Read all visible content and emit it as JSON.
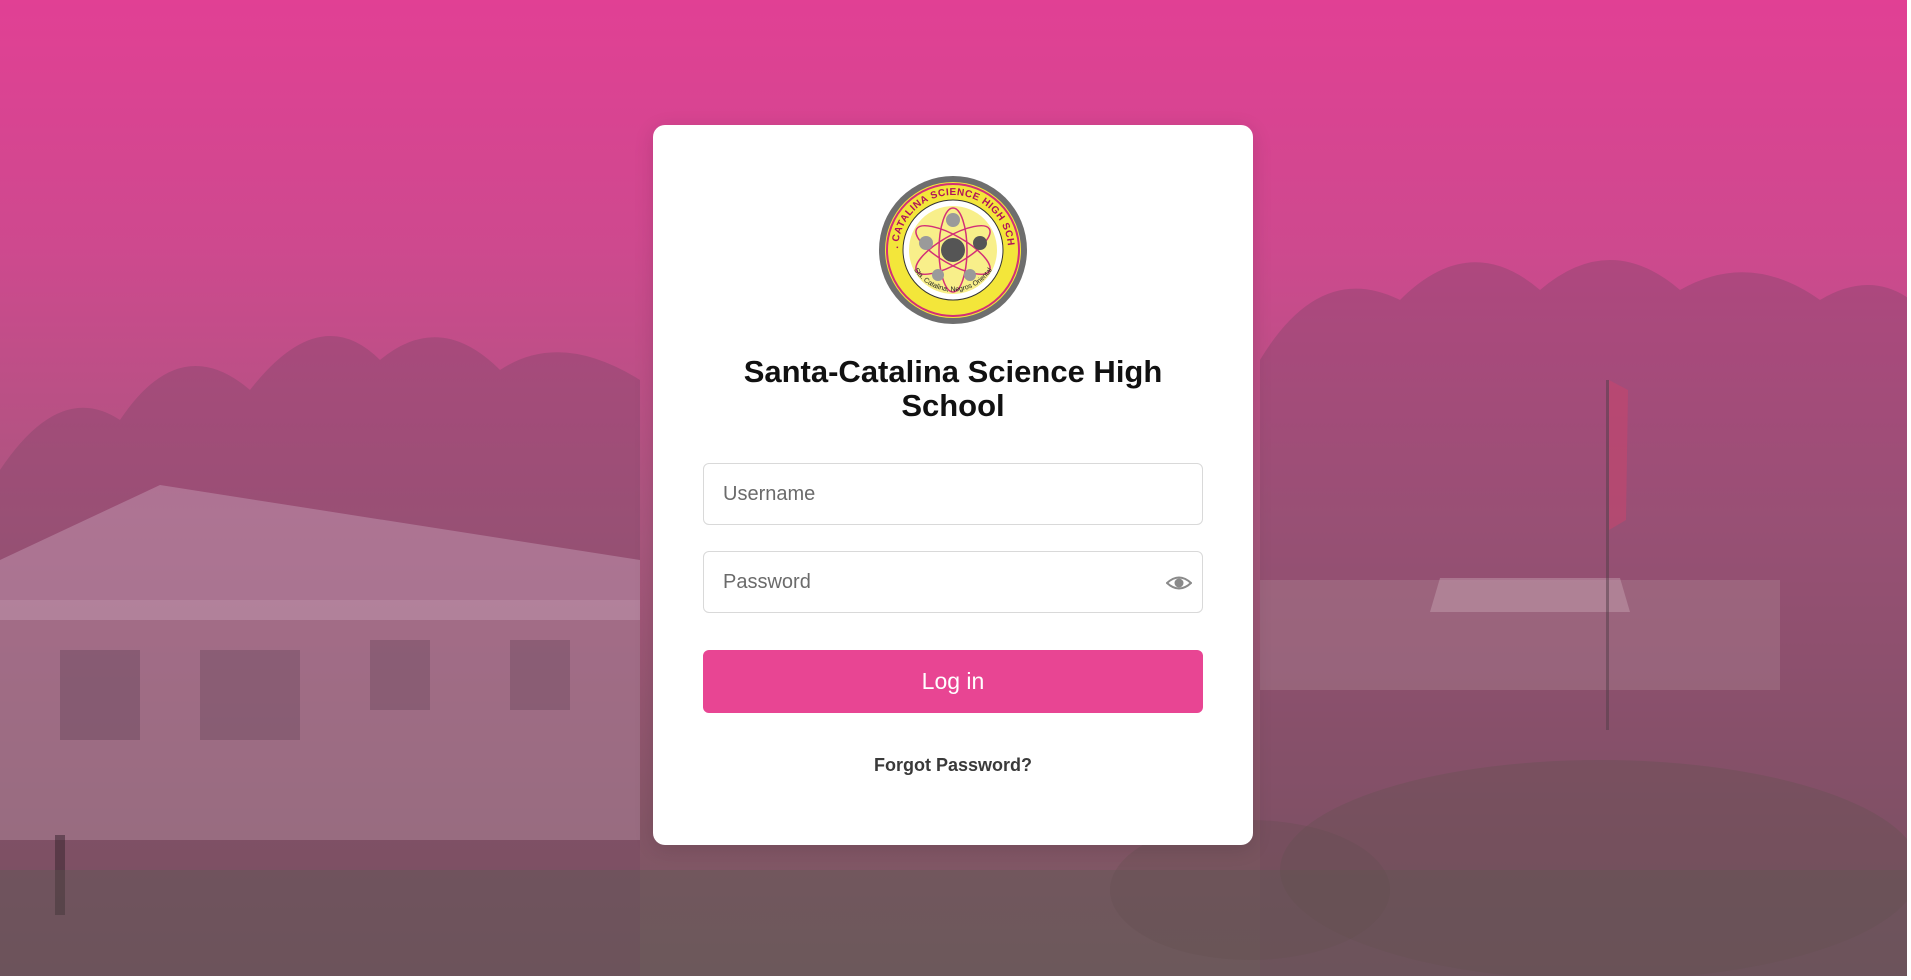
{
  "school": {
    "name": "Santa-Catalina Science High School",
    "seal_text_top": "STA. CATALINA SCIENCE HIGH SCHOOL",
    "seal_text_bottom": "Sta. Catalina, Negros Oriental"
  },
  "form": {
    "username_placeholder": "Username",
    "username_value": "",
    "password_placeholder": "Password",
    "password_value": "",
    "login_label": "Log in",
    "forgot_label": "Forgot Password?"
  },
  "icons": {
    "password_toggle": "eye-icon"
  },
  "colors": {
    "brand_pink": "#e84593",
    "background_pink": "#e04094"
  }
}
